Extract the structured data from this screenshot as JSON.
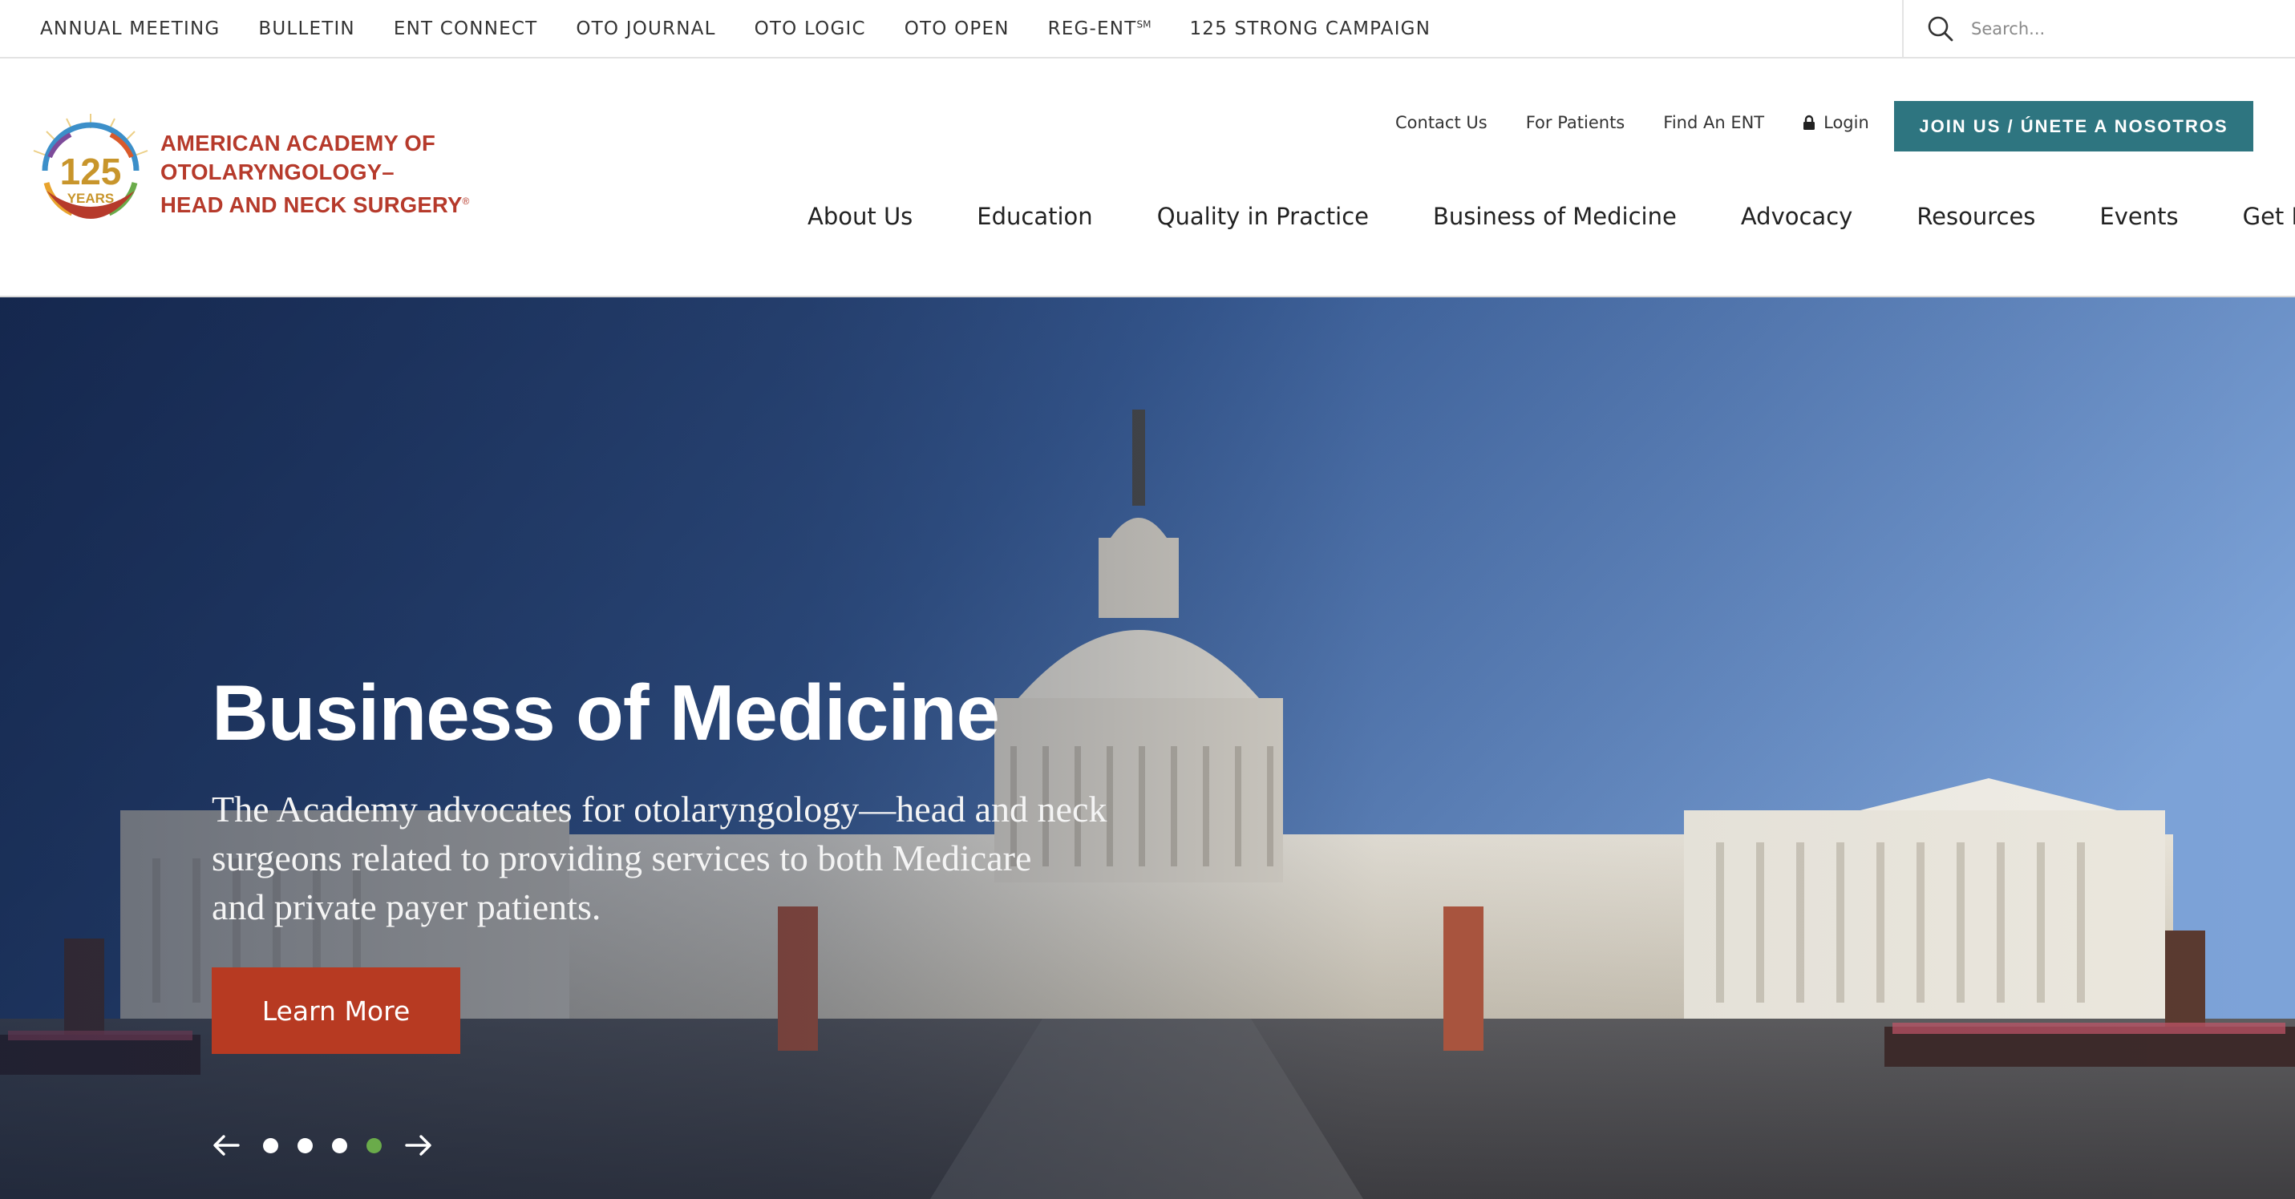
{
  "utility_bar": {
    "links": [
      {
        "label": "ANNUAL MEETING"
      },
      {
        "label": "BULLETIN"
      },
      {
        "label": "ENT CONNECT"
      },
      {
        "label": "OTO JOURNAL"
      },
      {
        "label": "OTO LOGIC"
      },
      {
        "label": "OTO OPEN"
      },
      {
        "label": "REG-ENT",
        "superscript": "SM"
      },
      {
        "label": "125 STRONG CAMPAIGN"
      }
    ],
    "search": {
      "placeholder": "Search..."
    }
  },
  "header": {
    "logo": {
      "badge_number": "125",
      "badge_text": "YEARS",
      "lines": [
        "AMERICAN ACADEMY OF",
        "OTOLARYNGOLOGY–",
        "HEAD AND NECK SURGERY"
      ],
      "registered_mark": "®"
    },
    "secondary_nav": {
      "contact": "Contact Us",
      "patients": "For Patients",
      "find_ent": "Find An ENT",
      "login": "Login"
    },
    "join_button": "JOIN US / ÚNETE A NOSOTROS",
    "main_nav": [
      {
        "label": "About Us"
      },
      {
        "label": "Education"
      },
      {
        "label": "Quality in Practice"
      },
      {
        "label": "Business of Medicine"
      },
      {
        "label": "Advocacy"
      },
      {
        "label": "Resources"
      },
      {
        "label": "Events"
      },
      {
        "label": "Get Involved"
      }
    ]
  },
  "hero": {
    "title": "Business of Medicine",
    "body_lines": [
      "The Academy advocates for otolaryngology—head and neck",
      "surgeons related to providing services to both Medicare",
      "and private payer patients."
    ],
    "cta": "Learn More",
    "slide_count": 4,
    "active_slide": 4
  },
  "colors": {
    "brand_red": "#b63a2b",
    "teal": "#2e7580",
    "cta_red": "#b73a22",
    "active_dot": "#6aab4a"
  }
}
